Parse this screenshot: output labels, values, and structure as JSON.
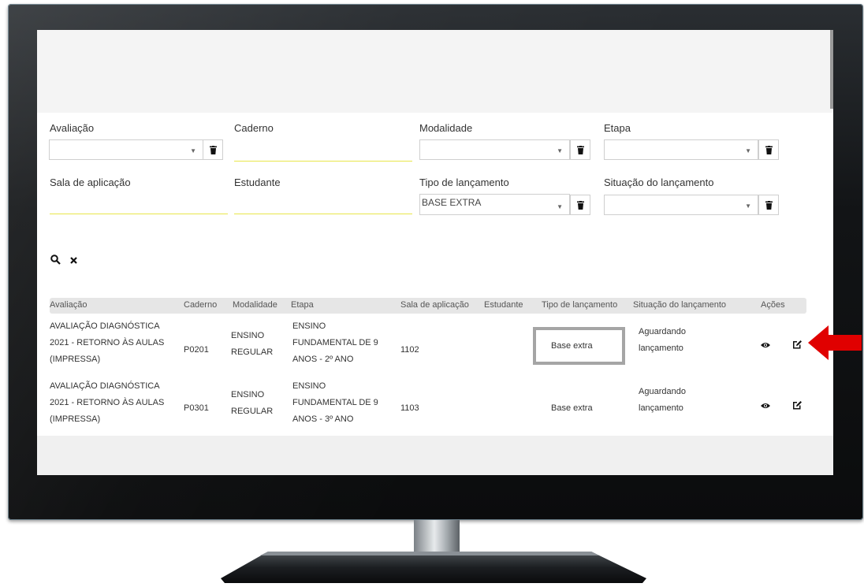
{
  "filters": {
    "avaliacao_label": "Avaliação",
    "caderno_label": "Caderno",
    "modalidade_label": "Modalidade",
    "etapa_label": "Etapa",
    "sala_label": "Sala de aplicação",
    "estudante_label": "Estudante",
    "tipo_label": "Tipo de lançamento",
    "tipo_value": "BASE EXTRA",
    "situacao_label": "Situação do lançamento"
  },
  "table": {
    "headers": [
      "Avaliação",
      "Caderno",
      "Modalidade",
      "Etapa",
      "Sala de aplicação",
      "Estudante",
      "Tipo de lançamento",
      "Situação do lançamento",
      "Ações"
    ],
    "rows": [
      {
        "avaliacao": [
          "AVALIAÇÃO DIAGNÓSTICA",
          "2021 - RETORNO ÀS AULAS",
          "(IMPRESSA)"
        ],
        "caderno": "P0201",
        "modalidade": [
          "ENSINO",
          "REGULAR"
        ],
        "etapa": [
          "ENSINO",
          "FUNDAMENTAL DE 9",
          "ANOS - 2º ANO"
        ],
        "sala": "1102",
        "estudante": "",
        "tipo": "Base extra",
        "situacao": [
          "Aguardando",
          "lançamento"
        ]
      },
      {
        "avaliacao": [
          "AVALIAÇÃO DIAGNÓSTICA",
          "2021 - RETORNO ÀS AULAS",
          "(IMPRESSA)"
        ],
        "caderno": "P0301",
        "modalidade": [
          "ENSINO",
          "REGULAR"
        ],
        "etapa": [
          "ENSINO",
          "FUNDAMENTAL DE 9",
          "ANOS - 3º ANO"
        ],
        "sala": "1103",
        "estudante": "",
        "tipo": "Base extra",
        "situacao": [
          "Aguardando",
          "lançamento"
        ]
      }
    ]
  },
  "colors": {
    "highlight_border": "#a5a5a5",
    "underline": "#e8e64a",
    "arrow": "#e00000"
  },
  "icons": {
    "search": "search-icon",
    "clear": "close-icon",
    "view": "eye-icon",
    "edit": "edit-icon",
    "trash": "trash-icon",
    "caret": "caret-down-icon"
  }
}
